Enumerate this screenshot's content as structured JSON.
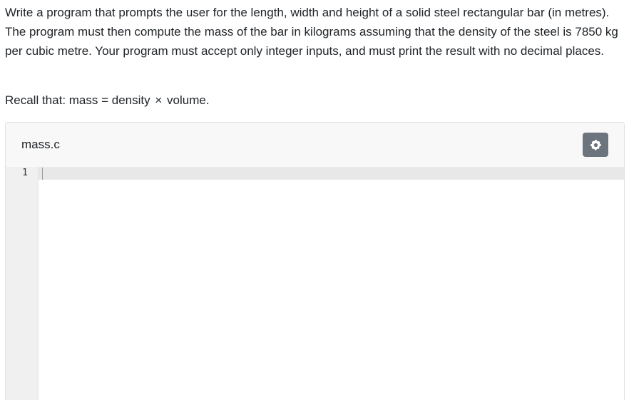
{
  "question": {
    "prompt_text": "Write a program that prompts the user for the length, width and height of a solid steel rectangular bar (in metres). The program must then compute the mass of the bar in kilograms assuming that the density of the steel is 7850 kg per cubic metre. Your program must accept only integer inputs, and must print the result with no decimal places.",
    "recall_prefix": "Recall that: mass = density",
    "recall_symbol": "×",
    "recall_suffix": "volume."
  },
  "editor": {
    "file_name": "mass.c",
    "settings_icon": "gear-icon",
    "line_numbers": [
      "1"
    ],
    "code": "",
    "colors": {
      "settings_button_bg": "#6c757d",
      "header_bg": "#f8f8f9",
      "gutter_bg": "#f0f0f0"
    }
  }
}
